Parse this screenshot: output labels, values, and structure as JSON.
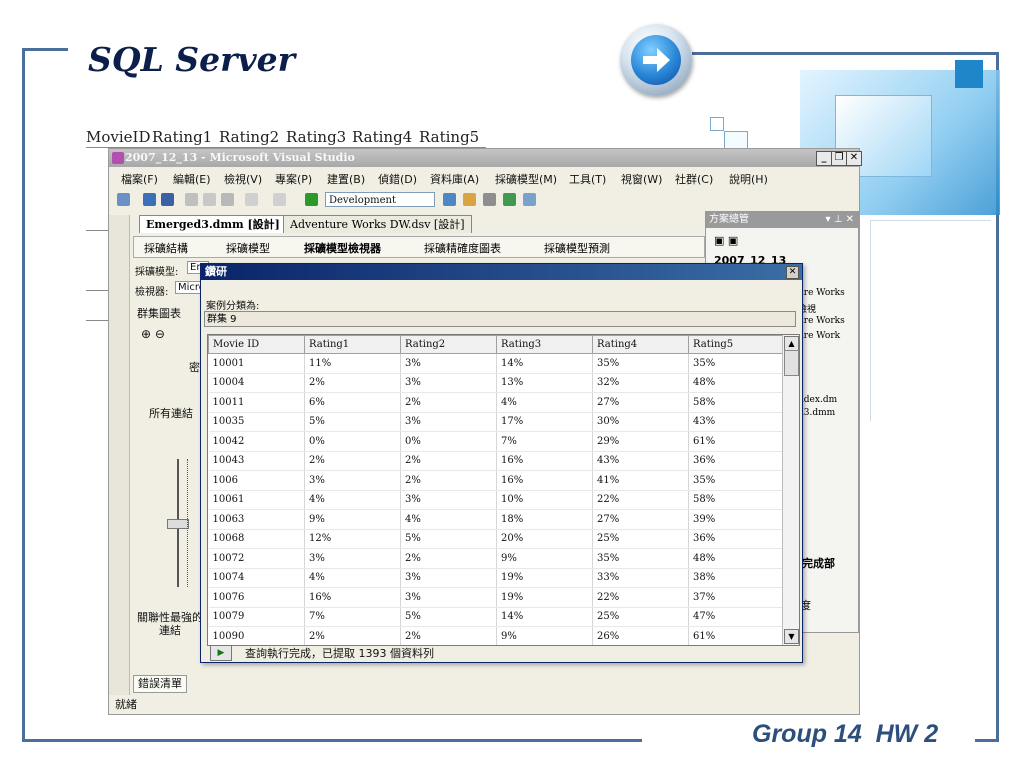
{
  "slide": {
    "title": "SQL Server",
    "footer": "Group 14  HW 2"
  },
  "background_header": [
    "MovieID",
    "Rating1",
    "Rating2",
    "Rating3",
    "Rating4",
    "Rating5"
  ],
  "vs": {
    "title": "2007_12_13 - Microsoft Visual Studio",
    "menu": [
      "檔案(F)",
      "編輯(E)",
      "檢視(V)",
      "專案(P)",
      "建置(B)",
      "偵錯(D)",
      "資料庫(A)",
      "採礦模型(M)",
      "工具(T)",
      "視窗(W)",
      "社群(C)",
      "說明(H)"
    ],
    "config_combo": "Development",
    "doc_tabs": [
      "Emerged3.dmm [設計]",
      "Adventure Works DW.dsv [設計]"
    ],
    "designer_tabs": [
      "採礦結構",
      "採礦模型",
      "採礦模型檢視器",
      "採礦精確度圖表",
      "採礦模型預測"
    ],
    "left": {
      "model_label": "採礦模型:",
      "model_value": "Em",
      "viewer_label": "檢視器:",
      "viewer_value": "Micro",
      "cluster_tab": "群集圖表",
      "density": "密",
      "all_links": "所有連結",
      "strongest": "關聯性最強的",
      "links": "連結"
    },
    "solution": {
      "header": "方案總管",
      "root": "2007_12_13",
      "items": [
        "ure Works",
        "檢視",
        "ure Works",
        "ure Work",
        "ndex.dm",
        "d3.dmm"
      ],
      "finish": "完成部",
      "degree": "度"
    },
    "error_list_tab": "錯誤清單",
    "status": "就緒"
  },
  "popup": {
    "title": "鑽研",
    "case_label": "案例分類為:",
    "case_value": "群集 9",
    "columns": [
      "Movie ID",
      "Rating1",
      "Rating2",
      "Rating3",
      "Rating4",
      "Rating5"
    ],
    "rows": [
      [
        "10001",
        "11%",
        "3%",
        "14%",
        "35%",
        "35%"
      ],
      [
        "10004",
        "2%",
        "3%",
        "13%",
        "32%",
        "48%"
      ],
      [
        "10011",
        "6%",
        "2%",
        "4%",
        "27%",
        "58%"
      ],
      [
        "10035",
        "5%",
        "3%",
        "17%",
        "30%",
        "43%"
      ],
      [
        "10042",
        "0%",
        "0%",
        "7%",
        "29%",
        "61%"
      ],
      [
        "10043",
        "2%",
        "2%",
        "16%",
        "43%",
        "36%"
      ],
      [
        "1006",
        "3%",
        "2%",
        "16%",
        "41%",
        "35%"
      ],
      [
        "10061",
        "4%",
        "3%",
        "10%",
        "22%",
        "58%"
      ],
      [
        "10063",
        "9%",
        "4%",
        "18%",
        "27%",
        "39%"
      ],
      [
        "10068",
        "12%",
        "5%",
        "20%",
        "25%",
        "36%"
      ],
      [
        "10072",
        "3%",
        "2%",
        "9%",
        "35%",
        "48%"
      ],
      [
        "10074",
        "4%",
        "3%",
        "19%",
        "33%",
        "38%"
      ],
      [
        "10076",
        "16%",
        "3%",
        "19%",
        "22%",
        "37%"
      ],
      [
        "10079",
        "7%",
        "5%",
        "14%",
        "25%",
        "47%"
      ],
      [
        "10090",
        "2%",
        "2%",
        "9%",
        "26%",
        "61%"
      ]
    ],
    "status": "查詢執行完成，已提取 1393 個資料列"
  }
}
